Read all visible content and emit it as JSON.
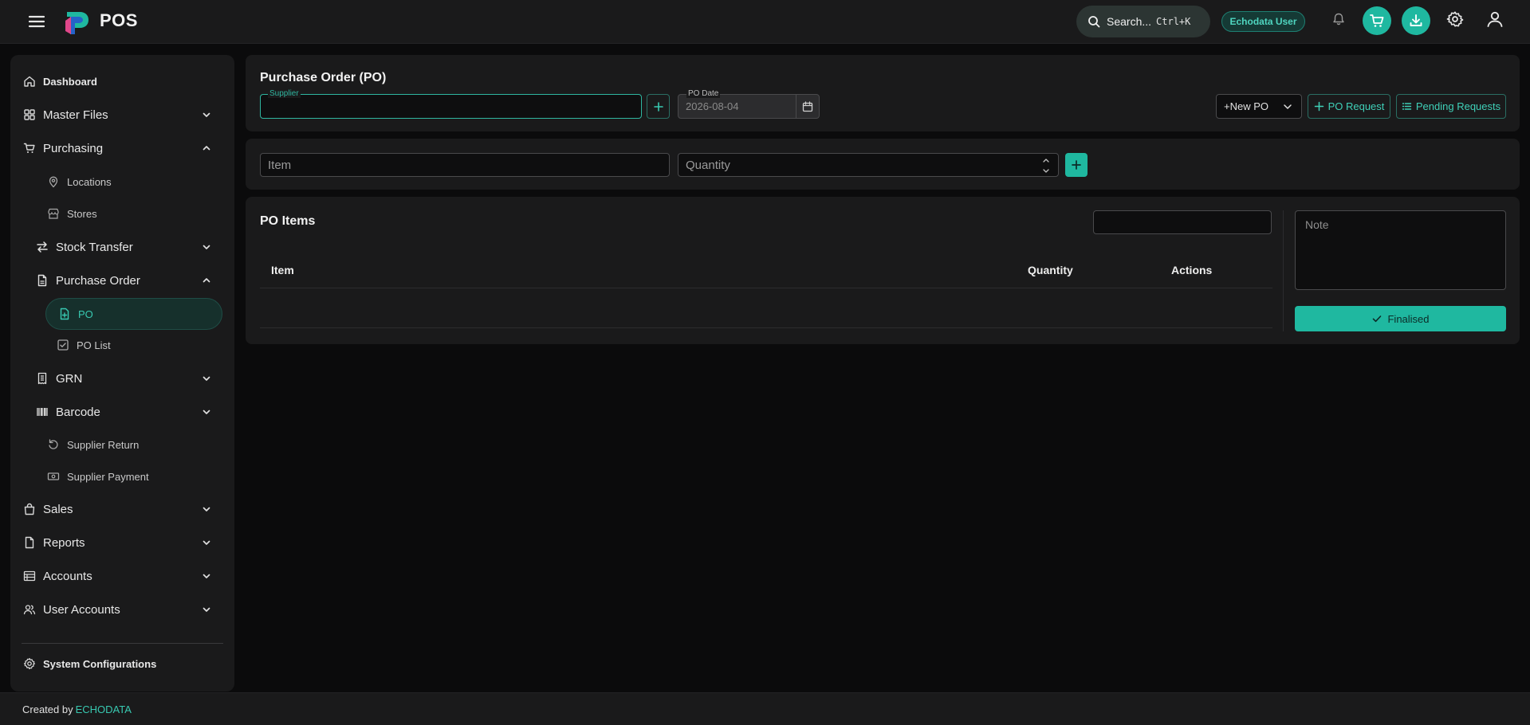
{
  "header": {
    "app_title": "POS",
    "search_label": "Search...",
    "search_shortcut": "Ctrl+K",
    "user_name": "Echodata User"
  },
  "sidebar": {
    "dashboard": "Dashboard",
    "master_files": "Master Files",
    "purchasing": "Purchasing",
    "locations": "Locations",
    "stores": "Stores",
    "stock_transfer": "Stock Transfer",
    "purchase_order": "Purchase Order",
    "po": "PO",
    "po_list": "PO List",
    "grn": "GRN",
    "barcode": "Barcode",
    "supplier_return": "Supplier Return",
    "supplier_payment": "Supplier Payment",
    "sales": "Sales",
    "reports": "Reports",
    "accounts": "Accounts",
    "user_accounts": "User Accounts",
    "system_configurations": "System Configurations"
  },
  "po_form": {
    "title": "Purchase Order (PO)",
    "supplier_label": "Supplier",
    "supplier_value": "",
    "po_date_label": "PO Date",
    "po_date_value": "2026-08-04",
    "new_po_label": "+New PO",
    "po_request_label": "PO Request",
    "pending_requests_label": "Pending Requests"
  },
  "item_entry": {
    "item_placeholder": "Item",
    "quantity_placeholder": "Quantity"
  },
  "po_items": {
    "title": "PO Items",
    "search_value": "",
    "columns": [
      "Item",
      "Quantity",
      "Actions"
    ],
    "rows": [],
    "note_placeholder": "Note",
    "finalised_label": "Finalised"
  },
  "footer": {
    "created_by": "Created by",
    "brand": "ECHODATA"
  },
  "colors": {
    "accent": "#1fb8a0",
    "background": "#0b0b0c",
    "panel": "#1a1a1b"
  }
}
